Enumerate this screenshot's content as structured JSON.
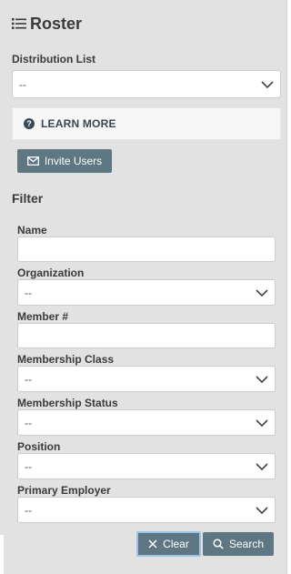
{
  "header": {
    "title": "Roster",
    "icon": "list-icon"
  },
  "distribution_list": {
    "label": "Distribution List",
    "value": "--"
  },
  "learn_more": {
    "label": "LEARN MORE",
    "icon": "question-circle-icon"
  },
  "invite_users": {
    "label": "Invite Users",
    "icon": "envelope-icon"
  },
  "filter": {
    "title": "Filter",
    "name": {
      "label": "Name",
      "value": ""
    },
    "organization": {
      "label": "Organization",
      "value": "--"
    },
    "member_number": {
      "label": "Member #",
      "value": ""
    },
    "membership_class": {
      "label": "Membership Class",
      "value": "--"
    },
    "membership_status": {
      "label": "Membership Status",
      "value": "--"
    },
    "position": {
      "label": "Position",
      "value": "--"
    },
    "primary_employer": {
      "label": "Primary Employer",
      "value": "--"
    }
  },
  "actions": {
    "clear": {
      "label": "Clear",
      "icon": "close-icon"
    },
    "search": {
      "label": "Search",
      "icon": "search-icon"
    }
  },
  "colors": {
    "panel_bg": "#e2e2e2",
    "button_bg": "#5f7783",
    "clear_focus": "#9ec3e6"
  }
}
